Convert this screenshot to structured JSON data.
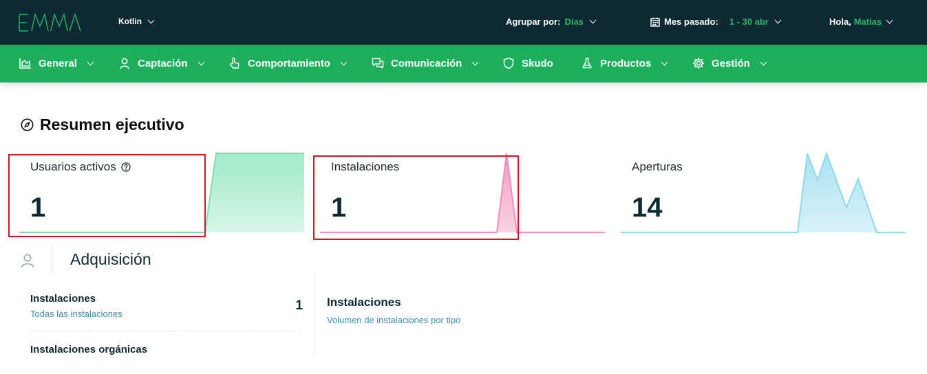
{
  "header": {
    "logo_text": "EMMA",
    "app_name": "Kotlin",
    "group_by_label": "Agrupar por:",
    "group_by_value": "Días",
    "period_label": "Mes pasado:",
    "period_value": "1 - 30 abr",
    "greeting": "Hola,",
    "user_name": "Matias"
  },
  "nav": {
    "items": [
      {
        "label": "General",
        "icon": "chart-area-icon"
      },
      {
        "label": "Captación",
        "icon": "user-icon"
      },
      {
        "label": "Comportamiento",
        "icon": "hand-pointer-icon"
      },
      {
        "label": "Comunicación",
        "icon": "chat-icon"
      },
      {
        "label": "Skudo",
        "icon": "shield-icon"
      },
      {
        "label": "Productos",
        "icon": "flask-icon"
      },
      {
        "label": "Gestión",
        "icon": "gear-icon"
      }
    ]
  },
  "page": {
    "title": "Resumen ejecutivo"
  },
  "metrics": [
    {
      "label": "Usuarios activos",
      "value": "1",
      "color": "#8ee7bd"
    },
    {
      "label": "Instalaciones",
      "value": "1",
      "color": "#f28cb9"
    },
    {
      "label": "Aperturas",
      "value": "14",
      "color": "#8ed9ea"
    }
  ],
  "acquisition": {
    "title": "Adquisición",
    "rows": [
      {
        "name": "Instalaciones",
        "sub": "Todas las instalaciones",
        "value": "1"
      },
      {
        "name": "Instalaciones orgánicas",
        "sub": "",
        "value": ""
      }
    ],
    "panel": {
      "name": "Instalaciones",
      "sub": "Volumen de instalaciones por tipo"
    }
  },
  "colors": {
    "topbar": "#0d2a33",
    "navbar": "#1fae5b",
    "accent": "#2bb36a",
    "highlight": "#e0131a"
  }
}
